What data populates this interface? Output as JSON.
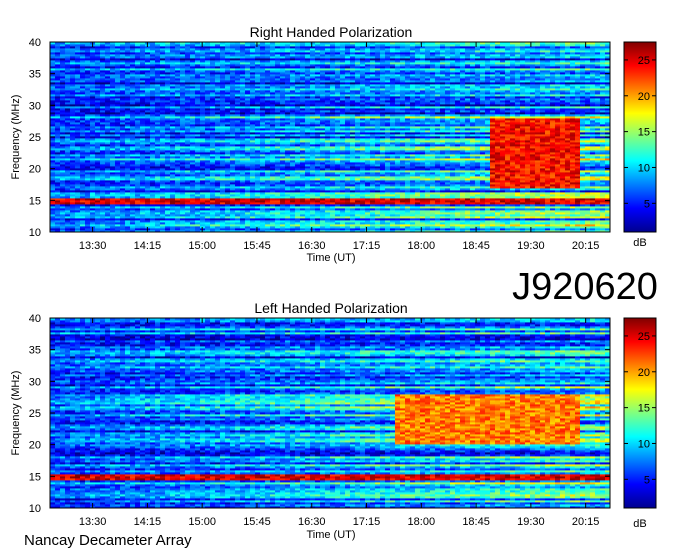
{
  "page": {
    "identifier": "J920620",
    "footer": "Nancay Decameter Array"
  },
  "chart_data": [
    {
      "type": "heatmap",
      "title": "Right Handed Polarization",
      "xlabel": "Time (UT)",
      "ylabel": "Frequency (MHz)",
      "x_ticks": [
        "13:30",
        "14:15",
        "15:00",
        "15:45",
        "16:30",
        "17:15",
        "18:00",
        "18:45",
        "19:30",
        "20:15"
      ],
      "y_ticks": [
        10,
        15,
        20,
        25,
        30,
        35,
        40
      ],
      "ylim": [
        10,
        40
      ],
      "xlim": [
        "12:55",
        "20:35"
      ],
      "colorbar": {
        "label": "dB",
        "ticks": [
          5,
          10,
          15,
          20,
          25
        ],
        "range": [
          1,
          27.5
        ],
        "colormap": [
          "#00008f",
          "#0000ff",
          "#00ffff",
          "#ffff00",
          "#ff0000",
          "#800000"
        ]
      },
      "features": [
        {
          "name": "strong emission band",
          "time": [
            "18:55",
            "20:10"
          ],
          "freq_mhz": [
            17,
            28
          ],
          "level_db": 24
        },
        {
          "name": "persistent band",
          "time": [
            "12:55",
            "20:35"
          ],
          "freq_mhz": [
            14.5,
            15.5
          ],
          "level_db": 25
        }
      ]
    },
    {
      "type": "heatmap",
      "title": "Left Handed Polarization",
      "xlabel": "Time (UT)",
      "ylabel": "Frequency (MHz)",
      "x_ticks": [
        "13:30",
        "14:15",
        "15:00",
        "15:45",
        "16:30",
        "17:15",
        "18:00",
        "18:45",
        "19:30",
        "20:15"
      ],
      "y_ticks": [
        10,
        15,
        20,
        25,
        30,
        35,
        40
      ],
      "ylim": [
        10,
        40
      ],
      "xlim": [
        "12:55",
        "20:35"
      ],
      "colorbar": {
        "label": "dB",
        "ticks": [
          5,
          10,
          15,
          20,
          25
        ],
        "range": [
          1,
          27.5
        ],
        "colormap": [
          "#00008f",
          "#0000ff",
          "#00ffff",
          "#ffff00",
          "#ff0000",
          "#800000"
        ]
      },
      "features": [
        {
          "name": "emission band",
          "time": [
            "17:40",
            "20:10"
          ],
          "freq_mhz": [
            20,
            28
          ],
          "level_db": 21
        },
        {
          "name": "persistent band",
          "time": [
            "12:55",
            "20:35"
          ],
          "freq_mhz": [
            14.5,
            15.5
          ],
          "level_db": 25
        }
      ]
    }
  ]
}
